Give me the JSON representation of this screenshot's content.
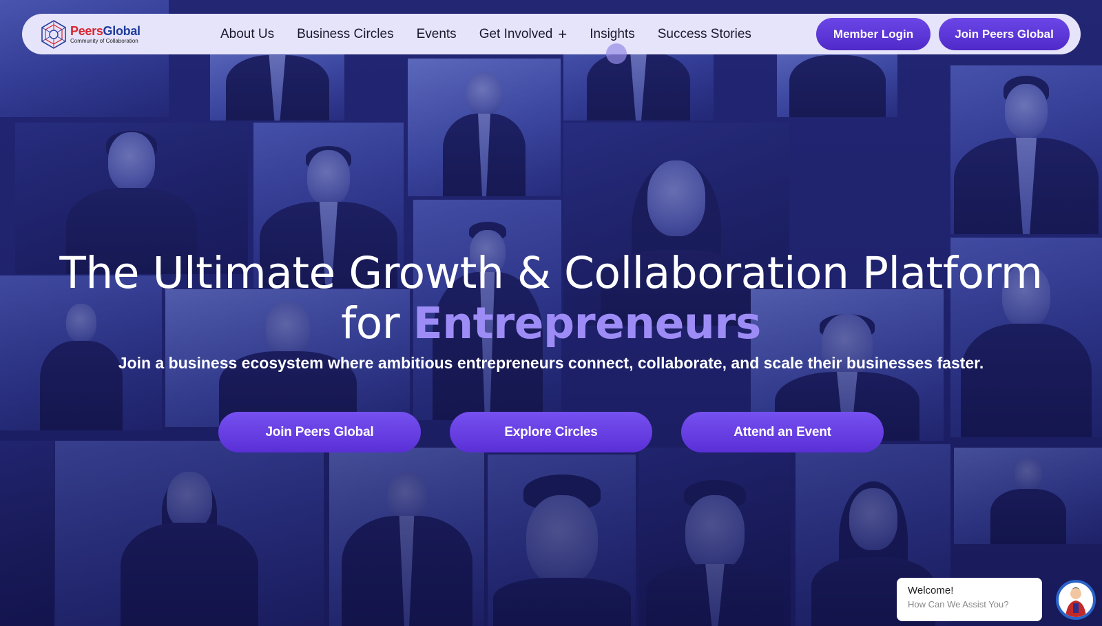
{
  "brand": {
    "name_part1": "Peers",
    "name_part2": "Global",
    "tagline": "Community of Collaboration"
  },
  "nav": {
    "links": [
      {
        "label": "About Us"
      },
      {
        "label": "Business Circles"
      },
      {
        "label": "Events"
      },
      {
        "label": "Get Involved",
        "icon": "plus-icon"
      },
      {
        "label": "Insights"
      },
      {
        "label": "Success Stories"
      }
    ],
    "member_login": "Member Login",
    "join": "Join Peers Global"
  },
  "hero": {
    "title_line1": "The Ultimate Growth & Collaboration Platform",
    "title_line2_prefix": "for",
    "title_line2_accent": "Entrepreneurs",
    "subtitle": "Join a business ecosystem where ambitious entrepreneurs connect, collaborate, and scale their businesses faster."
  },
  "cta": {
    "join": "Join Peers Global",
    "explore": "Explore Circles",
    "attend": "Attend an Event"
  },
  "chat": {
    "welcome": "Welcome!",
    "prompt": "How Can We Assist You?"
  },
  "colors": {
    "accent": "#5a30d6",
    "accent_text": "#9e8cf6",
    "nav_bg": "#e6e4fb",
    "brand_red": "#d8242f",
    "brand_blue": "#1f3c9a"
  }
}
